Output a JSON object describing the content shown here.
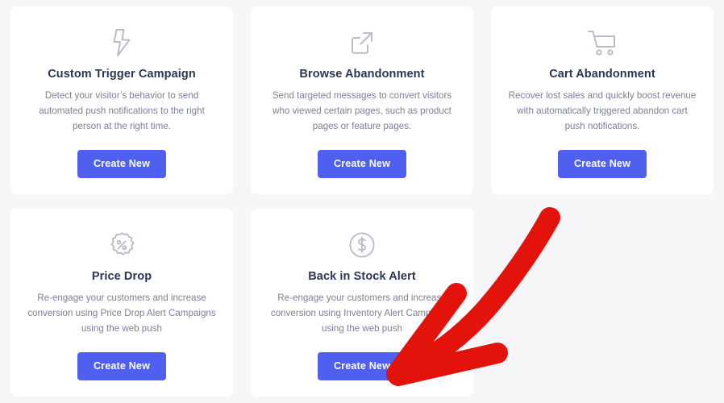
{
  "theme": {
    "page_background": "#f6f6f9",
    "card_background": "#ffffff",
    "title_color": "#2c3654",
    "body_color": "#7b8095",
    "icon_color": "#b9bccb",
    "button_color": "#4f5ff0",
    "button_text_color": "#ffffff",
    "annotation_color": "#e3120b"
  },
  "cards": [
    {
      "icon": "lightning-bolt-icon",
      "title": "Custom Trigger Campaign",
      "description": "Detect your visitor’s behavior to send automated push notifications to the right person at the right time.",
      "button_label": "Create New"
    },
    {
      "icon": "external-link-icon",
      "title": "Browse Abandonment",
      "description": "Send targeted messages to convert visitors who viewed certain pages, such as product pages or feature pages.",
      "button_label": "Create New"
    },
    {
      "icon": "shopping-cart-icon",
      "title": "Cart Abandonment",
      "description": "Recover lost sales and quickly boost revenue with automatically triggered abandon cart push notifications.",
      "button_label": "Create New"
    },
    {
      "icon": "percent-badge-icon",
      "title": "Price Drop",
      "description": "Re-engage your customers and increase conversion using Price Drop Alert Campaigns using the web push",
      "button_label": "Create New"
    },
    {
      "icon": "dollar-circle-icon",
      "title": "Back in Stock Alert",
      "description": "Re-engage your customers and increase conversion using Inventory Alert Campaigns using the web push",
      "button_label": "Create New"
    }
  ],
  "annotation": {
    "name": "red-curved-arrow",
    "points_to": "Create New",
    "color": "#e3120b"
  }
}
